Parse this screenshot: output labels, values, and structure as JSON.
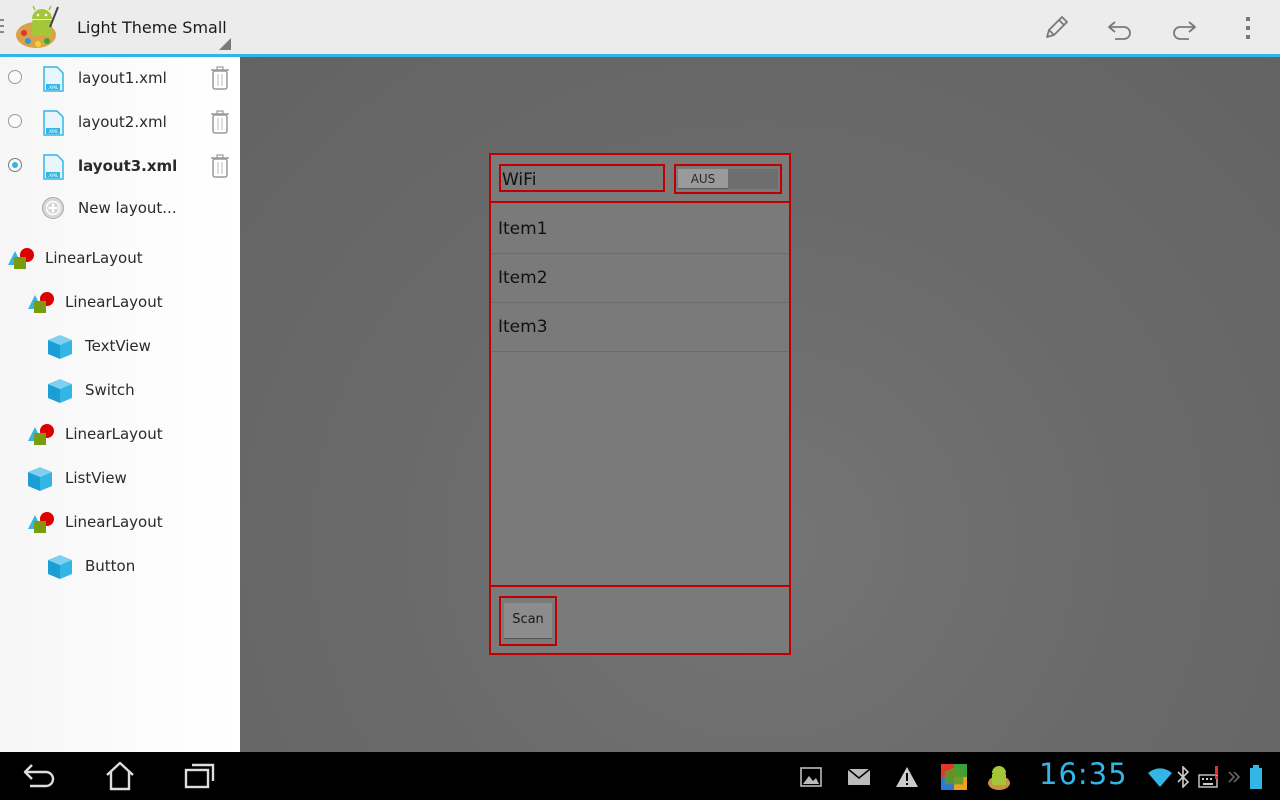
{
  "action_bar": {
    "title": "Light Theme Small",
    "actions": [
      {
        "name": "edit",
        "icon": "pencil-icon"
      },
      {
        "name": "undo",
        "icon": "undo-icon"
      },
      {
        "name": "redo",
        "icon": "redo-icon"
      },
      {
        "name": "overflow",
        "icon": "overflow-menu-icon"
      }
    ]
  },
  "files": [
    {
      "label": "layout1.xml",
      "selected": false
    },
    {
      "label": "layout2.xml",
      "selected": false
    },
    {
      "label": "layout3.xml",
      "selected": true
    }
  ],
  "new_layout_label": "New layout...",
  "tree": [
    {
      "label": "LinearLayout",
      "type": "layout",
      "depth": 0
    },
    {
      "label": "LinearLayout",
      "type": "layout",
      "depth": 1
    },
    {
      "label": "TextView",
      "type": "view",
      "depth": 2
    },
    {
      "label": "Switch",
      "type": "view",
      "depth": 2
    },
    {
      "label": "LinearLayout",
      "type": "layout",
      "depth": 1
    },
    {
      "label": "ListView",
      "type": "view",
      "depth": 1
    },
    {
      "label": "LinearLayout",
      "type": "layout",
      "depth": 1
    },
    {
      "label": "Button",
      "type": "view",
      "depth": 2
    }
  ],
  "preview": {
    "textview_text": "WiFi",
    "switch_text": "AUS",
    "list_items": [
      "Item1",
      "Item2",
      "Item3"
    ],
    "button_text": "Scan"
  },
  "system_bar": {
    "clock": "16:35",
    "nav_buttons": [
      "back-icon",
      "home-icon",
      "recent-apps-icon"
    ],
    "notification_icons": [
      "gallery-icon",
      "mail-icon",
      "warning-icon",
      "app-store-icon",
      "android-app-icon"
    ],
    "status_icons": [
      "wifi-icon",
      "bluetooth-icon",
      "keyboard-alert-icon",
      "battery-icon"
    ]
  },
  "colors": {
    "accent": "#33b5e5",
    "outline": "#c00000",
    "canvas": "#6a6a6a",
    "panel": "#f7f7f7"
  }
}
